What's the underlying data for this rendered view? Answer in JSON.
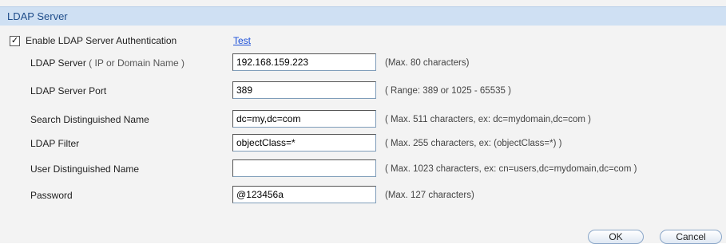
{
  "section": {
    "title": "LDAP Server"
  },
  "enable": {
    "checked": true,
    "label": "Enable LDAP Server Authentication",
    "test_link": "Test"
  },
  "fields": [
    {
      "label": "LDAP Server",
      "hint": "( IP or Domain Name )",
      "value": "192.168.159.223",
      "note": "(Max. 80 characters)"
    },
    {
      "label": "LDAP Server Port",
      "hint": "",
      "value": "389",
      "note": "( Range: 389 or 1025 - 65535 )"
    },
    {
      "label": "Search Distinguished Name",
      "hint": "",
      "value": "dc=my,dc=com",
      "note": "( Max. 511 characters, ex: dc=mydomain,dc=com )"
    },
    {
      "label": "LDAP Filter",
      "hint": "",
      "value": "objectClass=*",
      "note": "( Max. 255 characters, ex: (objectClass=*) )"
    },
    {
      "label": "User Distinguished Name",
      "hint": "",
      "value": "",
      "note": "( Max. 1023 characters, ex: cn=users,dc=mydomain,dc=com )"
    },
    {
      "label": "Password",
      "hint": "",
      "value": "@123456a",
      "note": "(Max. 127 characters)"
    }
  ],
  "buttons": {
    "ok": "OK",
    "cancel": "Cancel"
  }
}
